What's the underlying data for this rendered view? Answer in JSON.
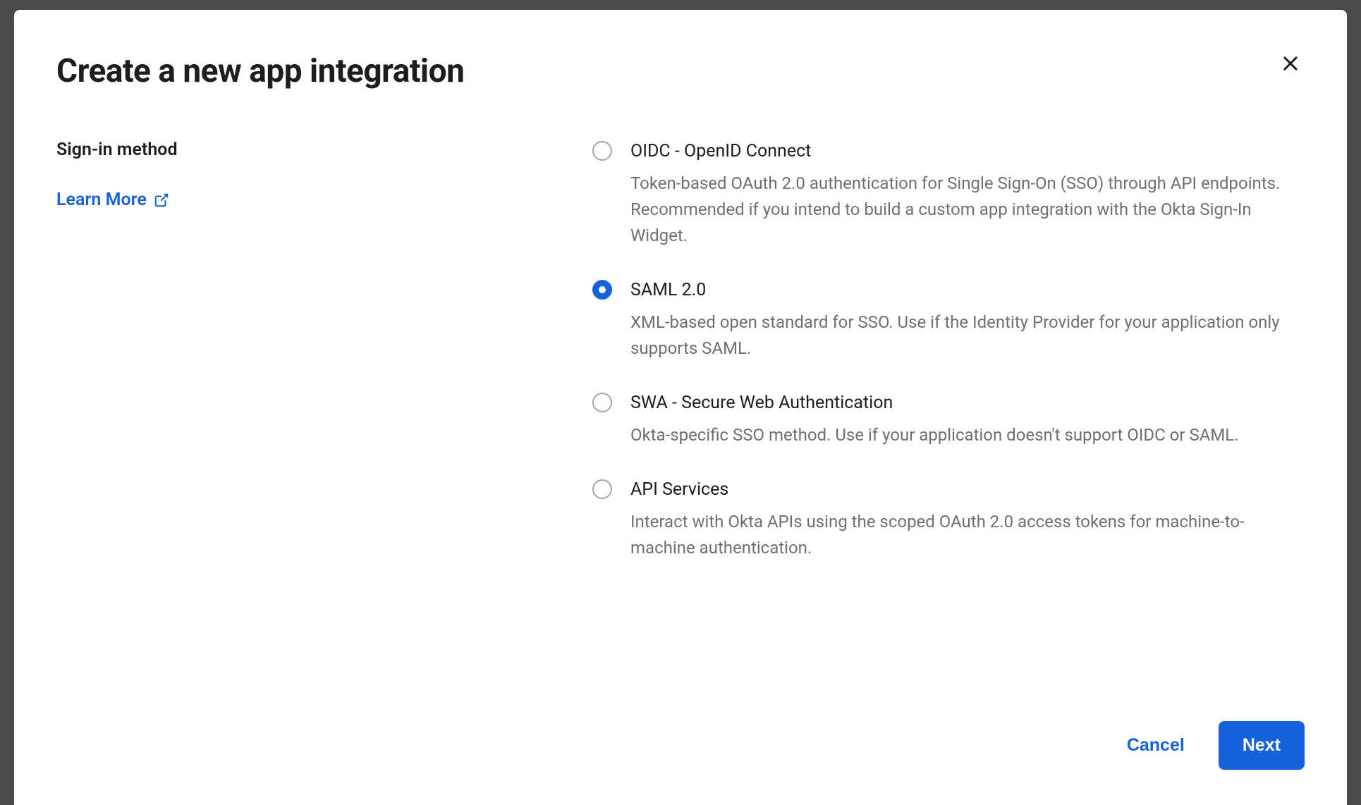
{
  "modal": {
    "title": "Create a new app integration",
    "close_label": "Close"
  },
  "section": {
    "label": "Sign-in method",
    "learn_more": "Learn More"
  },
  "options": [
    {
      "id": "oidc",
      "title": "OIDC - OpenID Connect",
      "description": "Token-based OAuth 2.0 authentication for Single Sign-On (SSO) through API endpoints. Recommended if you intend to build a custom app integration with the Okta Sign-In Widget.",
      "selected": false
    },
    {
      "id": "saml",
      "title": "SAML 2.0",
      "description": "XML-based open standard for SSO. Use if the Identity Provider for your application only supports SAML.",
      "selected": true
    },
    {
      "id": "swa",
      "title": "SWA - Secure Web Authentication",
      "description": "Okta-specific SSO method. Use if your application doesn't support OIDC or SAML.",
      "selected": false
    },
    {
      "id": "api",
      "title": "API Services",
      "description": "Interact with Okta APIs using the scoped OAuth 2.0 access tokens for machine-to-machine authentication.",
      "selected": false
    }
  ],
  "footer": {
    "cancel": "Cancel",
    "next": "Next"
  }
}
